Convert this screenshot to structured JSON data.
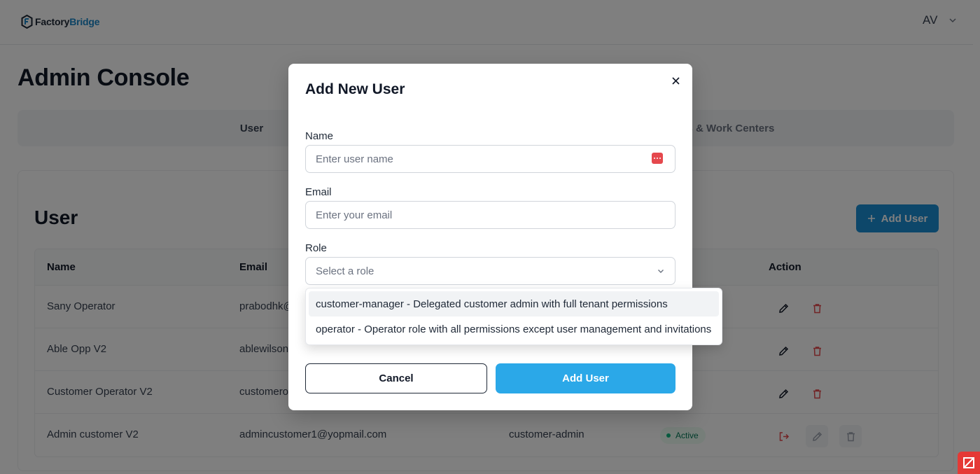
{
  "brand": {
    "name_part1": "Factory",
    "name_part2": "Bridge"
  },
  "user_menu": {
    "initials": "AV"
  },
  "page": {
    "title": "Admin Console"
  },
  "tabs": [
    {
      "label": "User"
    },
    {
      "label": "Lines & Work Centers"
    }
  ],
  "section": {
    "title": "User",
    "add_button_label": "Add User"
  },
  "table": {
    "headers": [
      "Name",
      "Email",
      "Action"
    ],
    "rows": [
      {
        "name": "Sany Operator",
        "email": "prabodhk@"
      },
      {
        "name": "Able Opp V2",
        "email": "ablewilson"
      },
      {
        "name": "Customer Operator V2",
        "email": "customero"
      },
      {
        "name": "Admin customer V2",
        "email": "admincustomer1@yopmail.com",
        "role": "customer-admin",
        "status": "Active"
      }
    ]
  },
  "modal": {
    "title": "Add New User",
    "name_label": "Name",
    "name_placeholder": "Enter user name",
    "email_label": "Email",
    "email_placeholder": "Enter your email",
    "role_label": "Role",
    "role_placeholder": "Select a role",
    "role_options": [
      "customer-manager - Delegated customer admin with full tenant permissions",
      "operator - Operator role with all permissions except user management and invitations"
    ],
    "cancel_label": "Cancel",
    "submit_label": "Add User"
  },
  "colors": {
    "primary": "#2ba8e8",
    "brand_accent": "#1a87c9",
    "danger": "#e5484d",
    "success": "#10b981"
  }
}
